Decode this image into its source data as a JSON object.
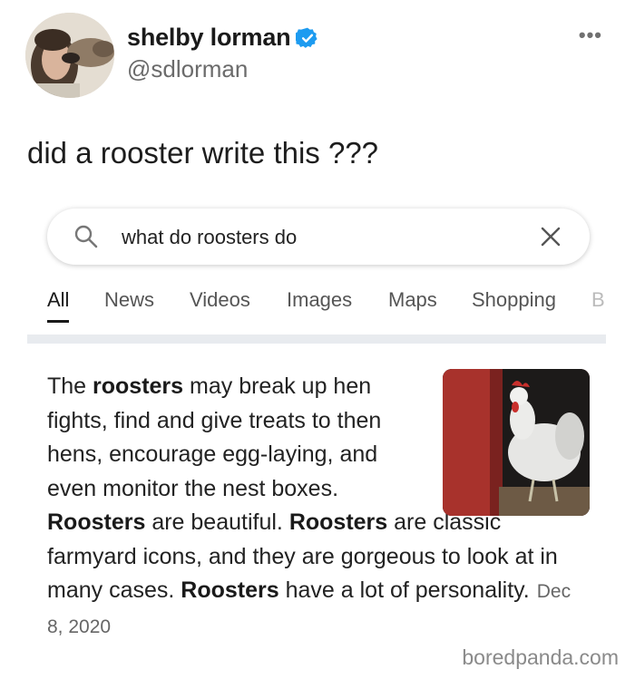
{
  "tweet": {
    "display_name": "shelby lorman",
    "handle": "@sdlorman",
    "text": "did a rooster write this ???",
    "more_icon": "more-horizontal-icon",
    "verified_icon": "verified-badge-icon"
  },
  "search": {
    "query": "what do roosters do",
    "search_icon": "search-icon",
    "clear_icon": "close-icon"
  },
  "tabs": [
    {
      "label": "All",
      "active": true
    },
    {
      "label": "News",
      "active": false
    },
    {
      "label": "Videos",
      "active": false
    },
    {
      "label": "Images",
      "active": false
    },
    {
      "label": "Maps",
      "active": false
    },
    {
      "label": "Shopping",
      "active": false
    },
    {
      "label": "B",
      "active": false
    }
  ],
  "snippet": {
    "parts": [
      "The ",
      "roosters",
      " may break up hen fights, find and give treats to then hens, encourage egg-laying, and even monitor the nest boxes. ",
      "Roosters",
      " are beautiful. ",
      "Roosters",
      " are classic farmyard icons, and they are gorgeous to look at in many cases. ",
      "Roosters",
      " have a lot of personality."
    ],
    "date": "Dec 8, 2020"
  },
  "colors": {
    "verified": "#1d9bf0",
    "accent": "#1a1a1a"
  },
  "watermark": "boredpanda.com"
}
